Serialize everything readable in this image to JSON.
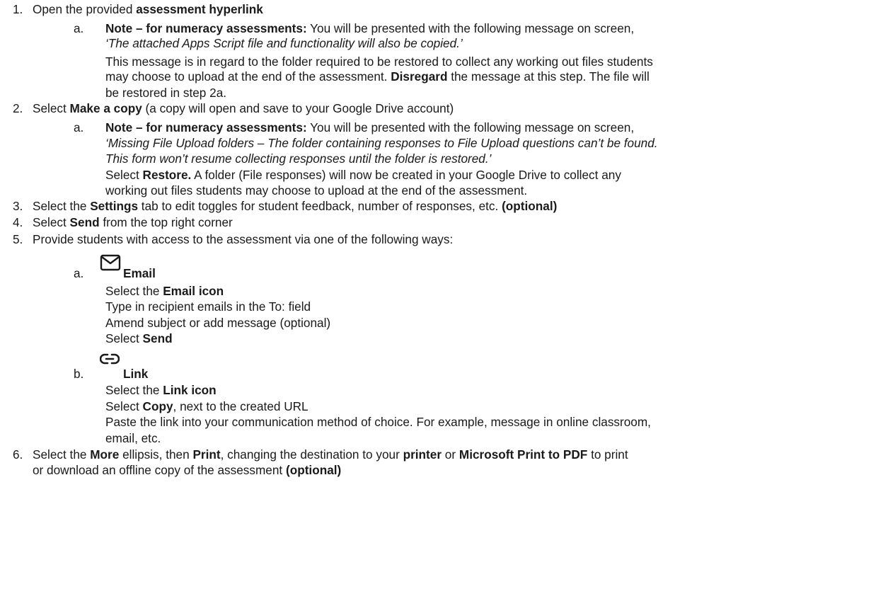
{
  "steps": [
    {
      "num": "1.",
      "parts": [
        {
          "t": "Open the provided ",
          "s": ""
        },
        {
          "t": "assessment hyperlink",
          "s": "b"
        }
      ],
      "sub": [
        {
          "letter": "a.",
          "lines": [
            [
              {
                "t": "Note – for numeracy assessments:",
                "s": "b"
              },
              {
                "t": " You will be presented with the following message on screen,",
                "s": ""
              }
            ],
            [
              {
                "t": "‘The attached Apps Script file and functionality will also be copied.’",
                "s": "i"
              }
            ],
            [
              {
                "t": "This message is in regard to the folder required to be restored to collect any working out files students",
                "s": ""
              }
            ],
            [
              {
                "t": "may choose to upload at the end of the assessment. ",
                "s": ""
              },
              {
                "t": "Disregard",
                "s": "b"
              },
              {
                "t": " the message at this step. The file will",
                "s": ""
              }
            ],
            [
              {
                "t": "be restored in step 2a.",
                "s": ""
              }
            ]
          ]
        }
      ]
    },
    {
      "num": "2.",
      "parts": [
        {
          "t": "Select ",
          "s": ""
        },
        {
          "t": "Make a copy",
          "s": "b"
        },
        {
          "t": " (a copy will open and save to your Google Drive account)",
          "s": ""
        }
      ],
      "sub": [
        {
          "letter": "a.",
          "lines": [
            [
              {
                "t": "Note – for numeracy assessments:",
                "s": "b"
              },
              {
                "t": " You will be presented with the following message on screen,",
                "s": ""
              }
            ],
            [
              {
                "t": "‘Missing File Upload folders – The folder containing responses to File Upload questions can’t be found.",
                "s": "i"
              }
            ],
            [
              {
                "t": "This form won’t resume collecting responses until the folder is restored.’",
                "s": "i"
              }
            ],
            [
              {
                "t": "Select ",
                "s": ""
              },
              {
                "t": "Restore.",
                "s": "b"
              },
              {
                "t": " A folder (File responses) will now be created in your Google Drive to collect any",
                "s": ""
              }
            ],
            [
              {
                "t": "working out files students may choose to upload at the end of the assessment.",
                "s": ""
              }
            ]
          ]
        }
      ]
    },
    {
      "num": "3.",
      "parts": [
        {
          "t": "Select the ",
          "s": ""
        },
        {
          "t": "Settings",
          "s": "b"
        },
        {
          "t": " tab to edit toggles for student feedback, number of responses, etc. ",
          "s": ""
        },
        {
          "t": "(optional)",
          "s": "b"
        }
      ]
    },
    {
      "num": "4.",
      "parts": [
        {
          "t": "Select ",
          "s": ""
        },
        {
          "t": "Send",
          "s": "b"
        },
        {
          "t": " from the top right corner",
          "s": ""
        }
      ]
    },
    {
      "num": "5.",
      "parts": [
        {
          "t": "Provide students with access to the assessment via one of the following ways:",
          "s": ""
        }
      ]
    }
  ],
  "email_option": {
    "letter": "a.",
    "icon": "mail-icon",
    "title": "Email",
    "lines": [
      [
        {
          "t": "Select the ",
          "s": ""
        },
        {
          "t": "Email icon",
          "s": "b"
        }
      ],
      [
        {
          "t": "Type in recipient emails in the To: field",
          "s": ""
        }
      ],
      [
        {
          "t": "Amend subject or add message (optional)",
          "s": ""
        }
      ],
      [
        {
          "t": "Select ",
          "s": ""
        },
        {
          "t": "Send",
          "s": "b"
        }
      ]
    ]
  },
  "link_option": {
    "letter": "b.",
    "icon": "link-icon",
    "title": "Link",
    "lines": [
      [
        {
          "t": "Select the ",
          "s": ""
        },
        {
          "t": "Link icon",
          "s": "b"
        }
      ],
      [
        {
          "t": "Select ",
          "s": ""
        },
        {
          "t": "Copy",
          "s": "b"
        },
        {
          "t": ", next to the created URL",
          "s": ""
        }
      ],
      [
        {
          "t": "Paste the link into your communication method of choice. For example, message in online classroom,",
          "s": ""
        }
      ],
      [
        {
          "t": "email, etc.",
          "s": ""
        }
      ]
    ]
  },
  "step6": {
    "num": "6.",
    "lines": [
      [
        {
          "t": "Select the ",
          "s": ""
        },
        {
          "t": "More",
          "s": "b"
        },
        {
          "t": " ellipsis, then ",
          "s": ""
        },
        {
          "t": "Print",
          "s": "b"
        },
        {
          "t": ", changing the destination to your ",
          "s": ""
        },
        {
          "t": "printer",
          "s": "b"
        },
        {
          "t": " or ",
          "s": ""
        },
        {
          "t": "Microsoft Print to PDF",
          "s": "b"
        },
        {
          "t": " to print",
          "s": ""
        }
      ],
      [
        {
          "t": "or download an offline copy of the assessment ",
          "s": ""
        },
        {
          "t": "(optional)",
          "s": "b"
        }
      ]
    ]
  }
}
